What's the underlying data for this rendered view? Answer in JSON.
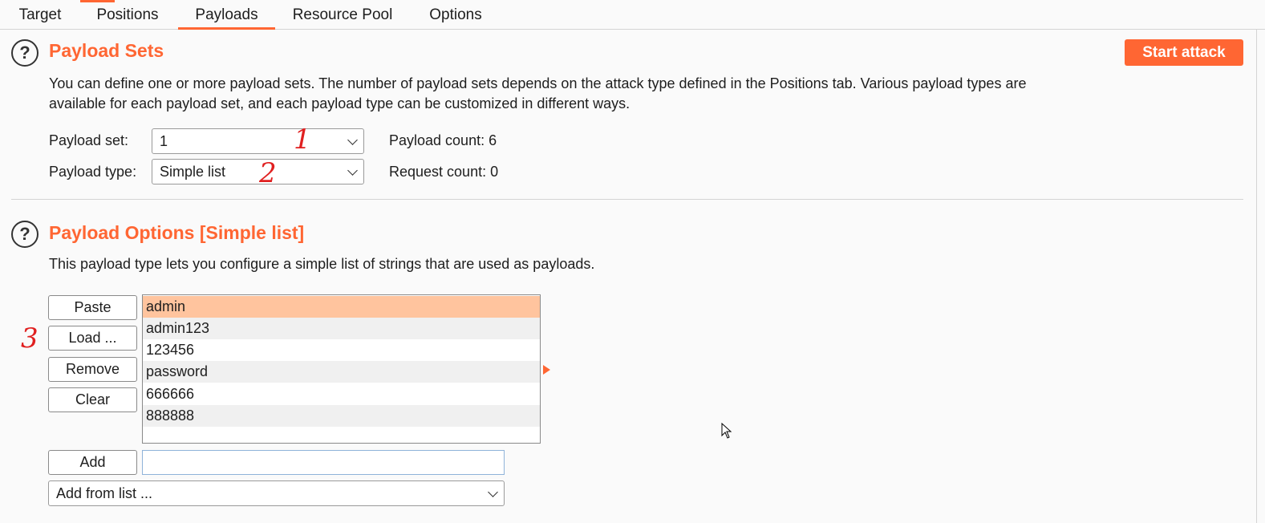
{
  "tabs": [
    {
      "label": "Target"
    },
    {
      "label": "Positions"
    },
    {
      "label": "Payloads"
    },
    {
      "label": "Resource Pool"
    },
    {
      "label": "Options"
    }
  ],
  "active_tab": "Payloads",
  "payload_sets": {
    "help_glyph": "?",
    "title": "Payload Sets",
    "description_line1": "You can define one or more payload sets. The number of payload sets depends on the attack type defined in the Positions tab. Various payload types are",
    "description_line2": "available for each payload set, and each payload type can be customized in different ways.",
    "payload_set_label": "Payload set:",
    "payload_set_value": "1",
    "payload_type_label": "Payload type:",
    "payload_type_value": "Simple list",
    "payload_count": "Payload count: 6",
    "request_count": "Request count: 0",
    "start_attack_label": "Start attack"
  },
  "payload_options": {
    "help_glyph": "?",
    "title": "Payload Options [Simple list]",
    "description": "This payload type lets you configure a simple list of strings that are used as payloads.",
    "buttons": {
      "paste": "Paste",
      "load": "Load ...",
      "remove": "Remove",
      "clear": "Clear",
      "add": "Add"
    },
    "items": [
      "admin",
      "admin123",
      "123456",
      "password",
      "666666",
      "888888"
    ],
    "selected_index": 0,
    "add_input_value": "",
    "add_from_list": "Add from list ..."
  },
  "annotations": {
    "a1": "1",
    "a2": "2",
    "a3": "3"
  },
  "colors": {
    "accent": "#ff6633",
    "selected_row": "#ffc49e",
    "annotation": "#e02020"
  }
}
